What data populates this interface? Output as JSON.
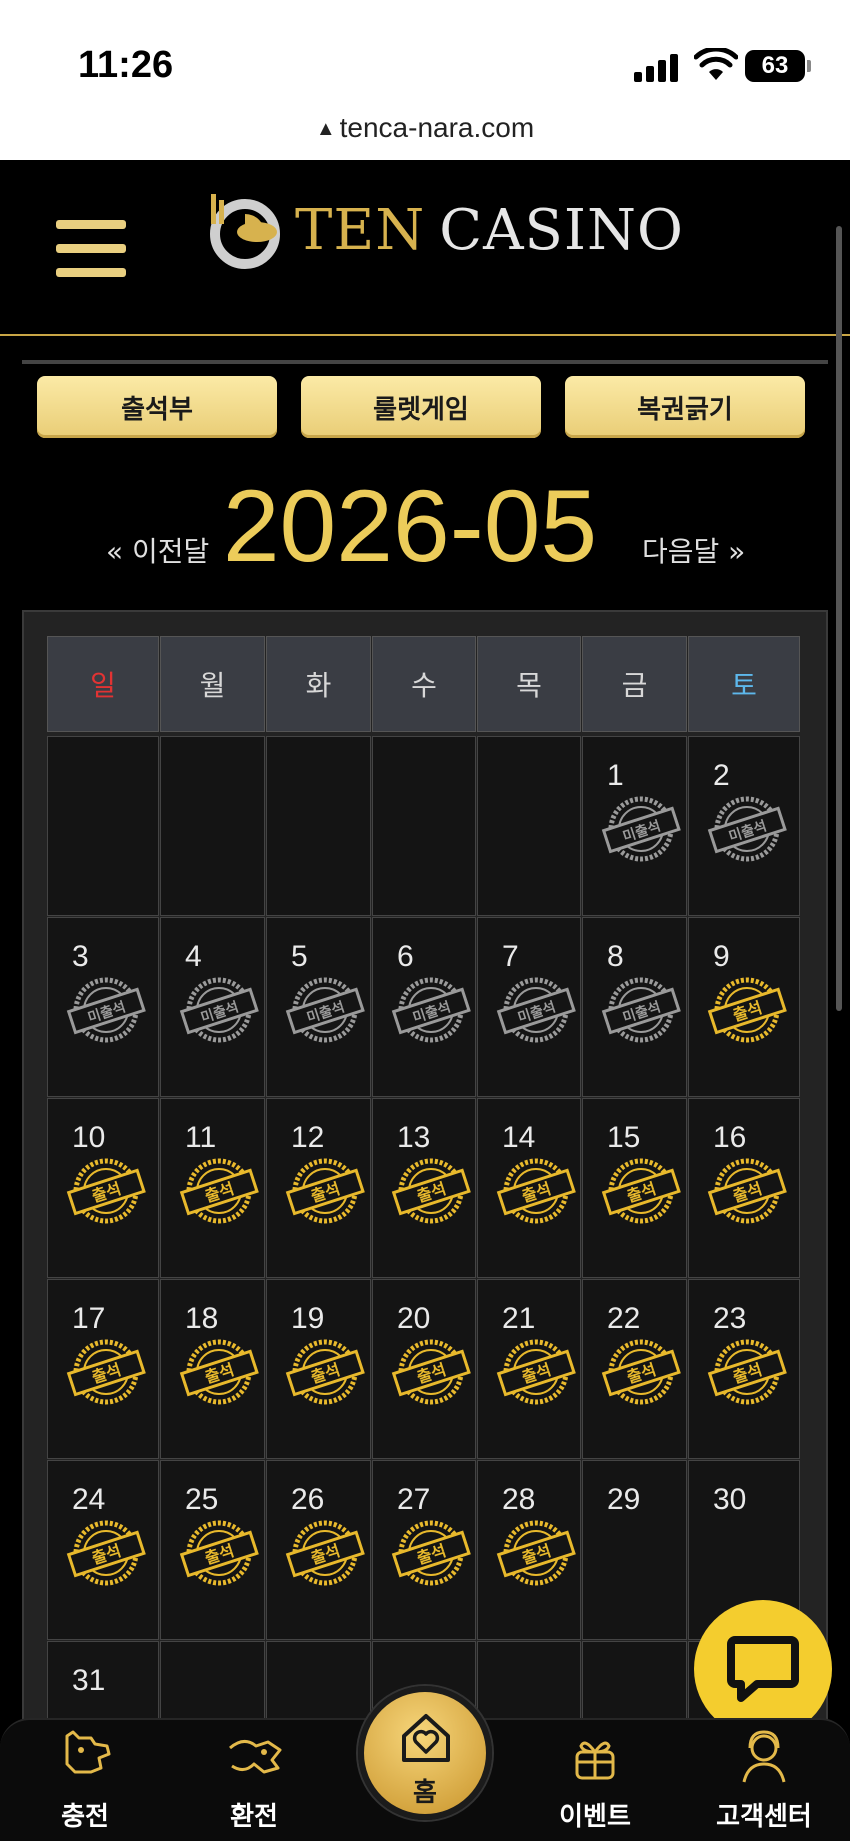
{
  "status_bar": {
    "time": "11:26",
    "battery": "63",
    "url": "tenca-nara.com"
  },
  "header": {
    "logo_ten": "TEN",
    "logo_casino": "CASINO"
  },
  "tabs": [
    "출석부",
    "룰렛게임",
    "복권긁기"
  ],
  "month_nav": {
    "prev": "« 이전달",
    "current": "2026-05",
    "next": "다음달 »"
  },
  "weekdays": [
    "일",
    "월",
    "화",
    "수",
    "목",
    "금",
    "토"
  ],
  "colors": {
    "gold": "#eccc5a",
    "sunday": "#e23333",
    "saturday": "#5db8ec",
    "attend_stamp": "#e8b92c",
    "absent_stamp": "#9a9a9a"
  },
  "calendar": {
    "first_weekday": 5,
    "days_in_month": 31,
    "stamp_labels": {
      "absent": "미출석",
      "attended": "출석"
    },
    "days": [
      {
        "d": 1,
        "s": "absent"
      },
      {
        "d": 2,
        "s": "absent"
      },
      {
        "d": 3,
        "s": "absent"
      },
      {
        "d": 4,
        "s": "absent"
      },
      {
        "d": 5,
        "s": "absent"
      },
      {
        "d": 6,
        "s": "absent"
      },
      {
        "d": 7,
        "s": "absent"
      },
      {
        "d": 8,
        "s": "absent"
      },
      {
        "d": 9,
        "s": "attended"
      },
      {
        "d": 10,
        "s": "attended"
      },
      {
        "d": 11,
        "s": "attended"
      },
      {
        "d": 12,
        "s": "attended"
      },
      {
        "d": 13,
        "s": "attended"
      },
      {
        "d": 14,
        "s": "attended"
      },
      {
        "d": 15,
        "s": "attended"
      },
      {
        "d": 16,
        "s": "attended"
      },
      {
        "d": 17,
        "s": "attended"
      },
      {
        "d": 18,
        "s": "attended"
      },
      {
        "d": 19,
        "s": "attended"
      },
      {
        "d": 20,
        "s": "attended"
      },
      {
        "d": 21,
        "s": "attended"
      },
      {
        "d": 22,
        "s": "attended"
      },
      {
        "d": 23,
        "s": "attended"
      },
      {
        "d": 24,
        "s": "attended"
      },
      {
        "d": 25,
        "s": "attended"
      },
      {
        "d": 26,
        "s": "attended"
      },
      {
        "d": 27,
        "s": "attended"
      },
      {
        "d": 28,
        "s": "attended"
      },
      {
        "d": 29,
        "s": "none"
      },
      {
        "d": 30,
        "s": "none"
      },
      {
        "d": 31,
        "s": "none"
      }
    ]
  },
  "bottom_nav": [
    {
      "label": "충전",
      "icon": "charge-icon"
    },
    {
      "label": "환전",
      "icon": "exchange-icon"
    },
    {
      "label": "홈",
      "icon": "home-heart-icon"
    },
    {
      "label": "이벤트",
      "icon": "gift-icon"
    },
    {
      "label": "고객센터",
      "icon": "support-icon"
    }
  ]
}
